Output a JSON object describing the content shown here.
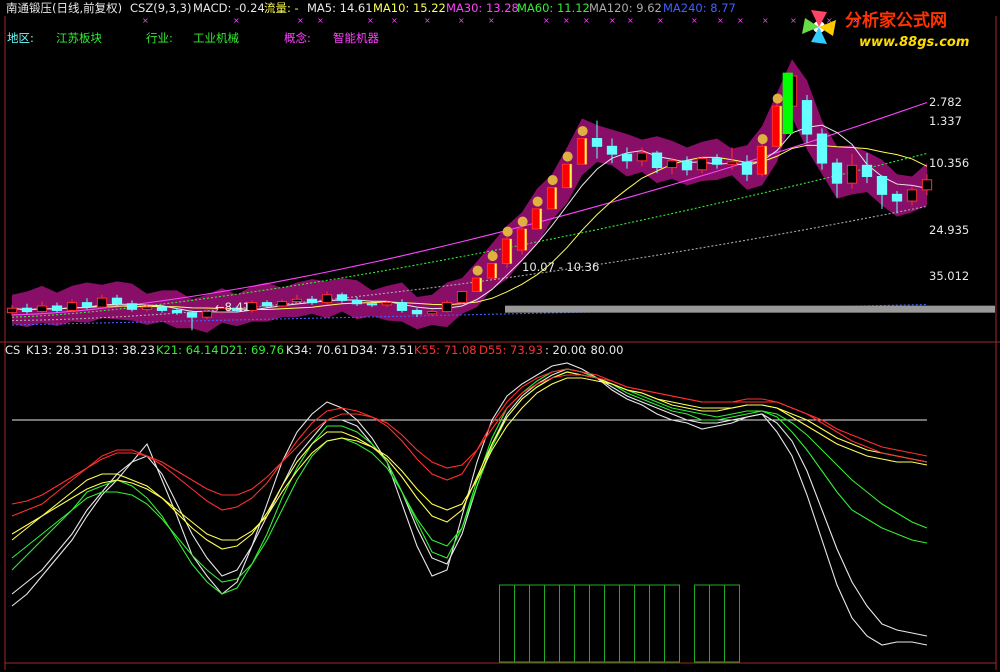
{
  "colors": {
    "white": "#e8e8e8",
    "yellow": "#ffff55",
    "magenta": "#ff44ff",
    "green": "#33ee33",
    "red": "#ff3030",
    "gray": "#aaaaaa",
    "blue": "#4060ff",
    "cyan": "#66ffff",
    "band": "#a0107a",
    "lime": "#00ff00",
    "grid": "#9a2a2a",
    "fillbar": "#ff0000",
    "lightgreen": "#88ff88",
    "darkgreen": "#22aa22"
  },
  "header": {
    "items": [
      {
        "text": "南通锻压(日线,前复权)",
        "color": "#e8e8e8"
      },
      {
        "text": "CSZ(9,3,3)",
        "color": "#e8e8e8"
      },
      {
        "text": "MACD: -0.24",
        "color": "#e8e8e8"
      },
      {
        "text": "流量: -",
        "color": "#ffff55"
      },
      {
        "text": "MA5: 14.61",
        "color": "#e8e8e8"
      },
      {
        "text": "MA10: 15.22",
        "color": "#ffff55"
      },
      {
        "text": "MA30: 13.28",
        "color": "#ff44ff"
      },
      {
        "text": "MA60: 11.12",
        "color": "#33ee33"
      },
      {
        "text": "MA120: 9.62",
        "color": "#aaaaaa"
      },
      {
        "text": "MA240: 8.77",
        "color": "#4060ff"
      }
    ]
  },
  "info": {
    "region_label": "地区:",
    "region_value": "江苏板块",
    "industry_label": "行业:",
    "industry_value": "工业机械",
    "concept_label": "概念:",
    "concept_value": "智能机器"
  },
  "logo": {
    "name": "分析家公式网",
    "url": "www.88gs.com"
  },
  "price_labels": [
    {
      "text": "2.782",
      "color": "#e8e8e8"
    },
    {
      "text": "1.337",
      "color": "#e8e8e8"
    },
    {
      "text": "10.356",
      "color": "#e8e8e8"
    },
    {
      "text": "24.935",
      "color": "#e8e8e8"
    },
    {
      "text": "35.012",
      "color": "#e8e8e8"
    }
  ],
  "annotations": {
    "range_label": "10.07 - 10.36",
    "low_label": "←8.41"
  },
  "indicator_header": {
    "items": [
      {
        "text": "CS",
        "color": "#e8e8e8"
      },
      {
        "text": "K13: 28.31",
        "color": "#e8e8e8"
      },
      {
        "text": "D13: 38.23",
        "color": "#e8e8e8"
      },
      {
        "text": "K21: 64.14",
        "color": "#33ee33"
      },
      {
        "text": "D21: 69.76",
        "color": "#33ee33"
      },
      {
        "text": "K34: 70.61",
        "color": "#e8e8e8"
      },
      {
        "text": "D34: 73.51",
        "color": "#e8e8e8"
      },
      {
        "text": "K55: 71.08",
        "color": "#ff3030"
      },
      {
        "text": "D55: 73.93",
        "color": "#ff3030"
      },
      {
        "text": ": 20.00",
        "color": "#e8e8e8"
      },
      {
        "text": ": 80.00",
        "color": "#e8e8e8"
      }
    ]
  },
  "chart_data": [
    {
      "type": "candlestick",
      "title": "南通锻压(日线,前复权)",
      "ylim": [
        8,
        35.5
      ],
      "candles": [
        {
          "o": 10.0,
          "c": 10.4,
          "h": 10.7,
          "l": 9.7
        },
        {
          "o": 10.4,
          "c": 10.1,
          "h": 10.8,
          "l": 9.9
        },
        {
          "o": 10.1,
          "c": 10.6,
          "h": 11.0,
          "l": 9.9
        },
        {
          "o": 10.6,
          "c": 10.2,
          "h": 10.9,
          "l": 10.0
        },
        {
          "o": 10.2,
          "c": 10.9,
          "h": 11.2,
          "l": 10.1
        },
        {
          "o": 10.9,
          "c": 10.5,
          "h": 11.3,
          "l": 10.3
        },
        {
          "o": 10.5,
          "c": 11.3,
          "h": 11.6,
          "l": 10.3
        },
        {
          "o": 11.3,
          "c": 10.8,
          "h": 11.6,
          "l": 10.6
        },
        {
          "o": 10.8,
          "c": 10.3,
          "h": 11.1,
          "l": 10.1
        },
        {
          "o": 10.3,
          "c": 10.5,
          "h": 10.8,
          "l": 10.1
        },
        {
          "o": 10.5,
          "c": 10.2,
          "h": 10.7,
          "l": 10.0
        },
        {
          "o": 10.2,
          "c": 10.0,
          "h": 10.4,
          "l": 9.8
        },
        {
          "o": 10.0,
          "c": 9.6,
          "h": 10.2,
          "l": 8.41
        },
        {
          "o": 9.6,
          "c": 10.1,
          "h": 10.3,
          "l": 9.4
        },
        {
          "o": 10.1,
          "c": 10.4,
          "h": 10.6,
          "l": 9.9
        },
        {
          "o": 10.4,
          "c": 10.2,
          "h": 10.6,
          "l": 10.0
        },
        {
          "o": 10.2,
          "c": 10.9,
          "h": 11.1,
          "l": 10.0
        },
        {
          "o": 10.9,
          "c": 10.6,
          "h": 11.1,
          "l": 10.4
        },
        {
          "o": 10.6,
          "c": 11.0,
          "h": 11.2,
          "l": 10.5
        },
        {
          "o": 11.0,
          "c": 11.2,
          "h": 11.6,
          "l": 10.8
        },
        {
          "o": 11.2,
          "c": 10.9,
          "h": 11.5,
          "l": 10.7
        },
        {
          "o": 10.9,
          "c": 11.6,
          "h": 11.9,
          "l": 10.7
        },
        {
          "o": 11.6,
          "c": 11.1,
          "h": 11.8,
          "l": 10.9
        },
        {
          "o": 11.1,
          "c": 10.8,
          "h": 11.4,
          "l": 10.6
        },
        {
          "o": 10.8,
          "c": 10.7,
          "h": 11.0,
          "l": 10.5
        },
        {
          "o": 10.7,
          "c": 10.9,
          "h": 11.1,
          "l": 10.5
        },
        {
          "o": 10.9,
          "c": 10.2,
          "h": 11.2,
          "l": 10.0
        },
        {
          "o": 10.2,
          "c": 9.9,
          "h": 10.4,
          "l": 9.6
        },
        {
          "o": 9.9,
          "c": 10.1,
          "h": 10.3,
          "l": 9.7
        },
        {
          "o": 10.1,
          "c": 10.9,
          "h": 11.1,
          "l": 10.0
        },
        {
          "o": 10.9,
          "c": 11.9,
          "h": 12.0,
          "l": 10.8
        },
        {
          "o": 11.9,
          "c": 13.1,
          "h": 13.1,
          "l": 11.9
        },
        {
          "o": 13.1,
          "c": 14.4,
          "h": 14.4,
          "l": 13.1
        },
        {
          "o": 14.4,
          "c": 16.6,
          "h": 17.0,
          "l": 14.0
        },
        {
          "o": 15.6,
          "c": 17.5,
          "h": 18.0,
          "l": 15.2
        },
        {
          "o": 17.5,
          "c": 19.3,
          "h": 19.3,
          "l": 17.5
        },
        {
          "o": 19.3,
          "c": 21.2,
          "h": 21.2,
          "l": 19.3
        },
        {
          "o": 21.2,
          "c": 23.3,
          "h": 23.3,
          "l": 21.2
        },
        {
          "o": 23.3,
          "c": 25.6,
          "h": 25.6,
          "l": 23.3
        },
        {
          "o": 25.6,
          "c": 24.9,
          "h": 27.2,
          "l": 23.8
        },
        {
          "o": 24.9,
          "c": 24.2,
          "h": 25.6,
          "l": 23.4
        },
        {
          "o": 24.2,
          "c": 23.6,
          "h": 24.8,
          "l": 22.9
        },
        {
          "o": 23.6,
          "c": 24.3,
          "h": 24.8,
          "l": 23.1
        },
        {
          "o": 24.3,
          "c": 23.0,
          "h": 24.5,
          "l": 22.5
        },
        {
          "o": 23.0,
          "c": 23.6,
          "h": 23.9,
          "l": 22.4
        },
        {
          "o": 23.6,
          "c": 22.8,
          "h": 24.0,
          "l": 22.3
        },
        {
          "o": 22.8,
          "c": 23.8,
          "h": 24.0,
          "l": 22.5
        },
        {
          "o": 23.8,
          "c": 23.3,
          "h": 24.2,
          "l": 22.9
        },
        {
          "o": 23.3,
          "c": 23.5,
          "h": 24.8,
          "l": 22.8
        },
        {
          "o": 23.5,
          "c": 22.4,
          "h": 24.1,
          "l": 21.8
        },
        {
          "o": 22.4,
          "c": 24.9,
          "h": 25.4,
          "l": 22.2
        },
        {
          "o": 24.9,
          "c": 28.5,
          "h": 29.5,
          "l": 24.9
        },
        {
          "o": 28.5,
          "c": 31.2,
          "h": 31.2,
          "l": 26.0
        },
        {
          "o": 29.0,
          "c": 26.0,
          "h": 29.5,
          "l": 25.2
        },
        {
          "o": 26.0,
          "c": 23.4,
          "h": 26.5,
          "l": 22.8
        },
        {
          "o": 23.4,
          "c": 21.6,
          "h": 23.8,
          "l": 20.3
        },
        {
          "o": 21.6,
          "c": 23.2,
          "h": 24.2,
          "l": 21.1
        },
        {
          "o": 23.2,
          "c": 22.2,
          "h": 24.3,
          "l": 21.6
        },
        {
          "o": 22.2,
          "c": 20.6,
          "h": 22.3,
          "l": 19.3
        },
        {
          "o": 20.6,
          "c": 20.0,
          "h": 20.9,
          "l": 18.9
        },
        {
          "o": 20.0,
          "c": 21.0,
          "h": 21.3,
          "l": 19.6
        },
        {
          "o": 21.0,
          "c": 21.9,
          "h": 22.4,
          "l": 20.5
        }
      ]
    },
    {
      "type": "line",
      "title": "CS",
      "ylim": [
        0,
        100
      ],
      "reference_lines": [
        20,
        80
      ],
      "series": [
        {
          "name": "K13",
          "color": "#e8e8e8",
          "values": [
            18,
            22,
            28,
            34,
            40,
            48,
            55,
            60,
            66,
            72,
            60,
            48,
            35,
            28,
            22,
            26,
            38,
            52,
            66,
            76,
            82,
            86,
            84,
            80,
            74,
            66,
            52,
            38,
            28,
            30,
            48,
            66,
            80,
            88,
            92,
            95,
            98,
            99,
            97,
            94,
            90,
            87,
            85,
            82,
            80,
            79,
            77,
            78,
            79,
            81,
            82,
            76,
            68,
            55,
            40,
            25,
            14,
            8,
            5,
            6,
            6,
            5
          ]
        },
        {
          "name": "D13",
          "color": "#e8e8e8",
          "values": [
            22,
            26,
            30,
            36,
            42,
            50,
            56,
            62,
            66,
            68,
            62,
            52,
            42,
            34,
            28,
            30,
            38,
            48,
            58,
            68,
            74,
            80,
            80,
            78,
            72,
            66,
            56,
            44,
            34,
            32,
            42,
            58,
            72,
            82,
            88,
            92,
            95,
            97,
            96,
            94,
            91,
            88,
            86,
            84,
            82,
            80,
            79,
            79,
            80,
            81,
            82,
            79,
            73,
            63,
            50,
            37,
            26,
            18,
            12,
            10,
            9,
            8
          ]
        },
        {
          "name": "K21",
          "color": "#33ee33",
          "values": [
            30,
            35,
            40,
            45,
            50,
            56,
            58,
            60,
            58,
            54,
            48,
            40,
            32,
            26,
            22,
            24,
            32,
            42,
            54,
            64,
            72,
            78,
            78,
            76,
            72,
            66,
            56,
            46,
            36,
            34,
            44,
            60,
            74,
            84,
            89,
            93,
            96,
            97,
            96,
            94,
            92,
            89,
            87,
            85,
            83,
            82,
            80,
            80,
            81,
            82,
            83,
            81,
            76,
            70,
            63,
            56,
            50,
            47,
            44,
            42,
            40,
            39
          ]
        },
        {
          "name": "D21",
          "color": "#33ee33",
          "values": [
            34,
            38,
            42,
            46,
            50,
            54,
            56,
            56,
            55,
            52,
            47,
            41,
            35,
            30,
            26,
            27,
            32,
            40,
            50,
            60,
            68,
            73,
            74,
            72,
            69,
            64,
            56,
            47,
            40,
            38,
            44,
            58,
            71,
            81,
            87,
            91,
            94,
            96,
            95,
            94,
            92,
            90,
            88,
            86,
            84,
            83,
            82,
            81,
            82,
            83,
            83,
            82,
            79,
            75,
            70,
            65,
            60,
            56,
            52,
            49,
            46,
            44
          ]
        },
        {
          "name": "K34",
          "color": "#ffff55",
          "values": [
            40,
            44,
            48,
            52,
            56,
            60,
            62,
            62,
            60,
            58,
            54,
            49,
            44,
            40,
            37,
            38,
            42,
            49,
            58,
            66,
            72,
            76,
            76,
            74,
            71,
            67,
            61,
            54,
            48,
            46,
            50,
            61,
            72,
            81,
            87,
            91,
            94,
            96,
            95,
            94,
            92,
            90,
            89,
            87,
            85,
            84,
            83,
            83,
            84,
            85,
            85,
            84,
            81,
            78,
            75,
            72,
            70,
            68,
            67,
            66,
            66,
            65
          ]
        },
        {
          "name": "D34",
          "color": "#ffff55",
          "values": [
            42,
            45,
            48,
            51,
            54,
            57,
            59,
            60,
            59,
            57,
            54,
            50,
            46,
            42,
            40,
            40,
            43,
            48,
            56,
            63,
            69,
            73,
            74,
            73,
            71,
            68,
            63,
            57,
            52,
            50,
            52,
            60,
            70,
            78,
            84,
            89,
            92,
            94,
            94,
            93,
            92,
            90,
            89,
            87,
            86,
            85,
            84,
            84,
            84,
            85,
            85,
            84,
            82,
            80,
            77,
            74,
            72,
            70,
            69,
            68,
            67,
            66
          ]
        },
        {
          "name": "K55",
          "color": "#ff3030",
          "values": [
            48,
            50,
            52,
            56,
            60,
            64,
            68,
            70,
            70,
            68,
            65,
            61,
            57,
            53,
            50,
            51,
            54,
            59,
            66,
            73,
            79,
            83,
            84,
            83,
            81,
            78,
            73,
            67,
            62,
            60,
            62,
            70,
            79,
            86,
            91,
            94,
            96,
            97,
            96,
            95,
            93,
            91,
            90,
            89,
            88,
            87,
            86,
            86,
            86,
            87,
            87,
            86,
            84,
            82,
            79,
            76,
            73,
            71,
            69,
            68,
            67,
            66
          ]
        },
        {
          "name": "D55",
          "color": "#ff3030",
          "values": [
            52,
            53,
            55,
            58,
            61,
            64,
            67,
            69,
            69,
            68,
            66,
            63,
            60,
            57,
            55,
            55,
            57,
            61,
            66,
            71,
            76,
            80,
            82,
            82,
            81,
            79,
            75,
            70,
            66,
            64,
            65,
            70,
            77,
            84,
            89,
            92,
            94,
            95,
            95,
            94,
            93,
            91,
            90,
            89,
            88,
            87,
            86,
            86,
            86,
            86,
            86,
            86,
            84,
            82,
            80,
            77,
            75,
            73,
            71,
            70,
            69,
            68
          ]
        }
      ]
    }
  ]
}
